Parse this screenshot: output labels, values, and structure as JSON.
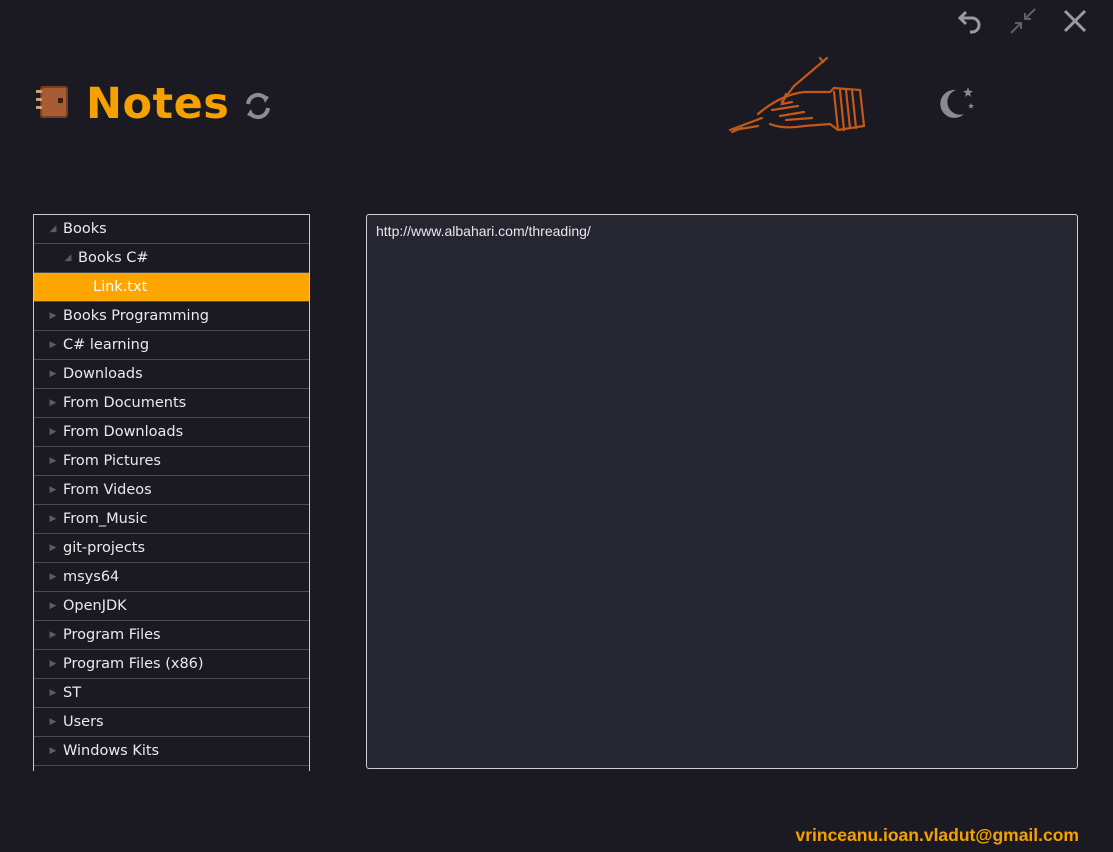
{
  "app": {
    "title": "Notes"
  },
  "window_controls": {
    "icons": [
      "undo-icon",
      "restore-icon",
      "close-icon"
    ]
  },
  "header": {
    "logo_icon": "notebook-icon",
    "refresh_icon": "refresh-icon",
    "illustration": "writing-hand-quill-illustration",
    "theme_icon": "moon-stars-icon"
  },
  "tree": {
    "items": [
      {
        "label": "Books",
        "level": 0,
        "expanded": true
      },
      {
        "label": "Books C#",
        "level": 1,
        "expanded": true
      },
      {
        "label": "Link.txt",
        "level": 2,
        "selected": true
      },
      {
        "label": "Books Programming",
        "level": 0
      },
      {
        "label": "C# learning",
        "level": 0
      },
      {
        "label": "Downloads",
        "level": 0
      },
      {
        "label": "From Documents",
        "level": 0
      },
      {
        "label": "From Downloads",
        "level": 0
      },
      {
        "label": "From Pictures",
        "level": 0
      },
      {
        "label": "From Videos",
        "level": 0
      },
      {
        "label": "From_Music",
        "level": 0
      },
      {
        "label": "git-projects",
        "level": 0
      },
      {
        "label": "msys64",
        "level": 0
      },
      {
        "label": "OpenJDK",
        "level": 0
      },
      {
        "label": "Program Files",
        "level": 0
      },
      {
        "label": "Program Files (x86)",
        "level": 0
      },
      {
        "label": "ST",
        "level": 0
      },
      {
        "label": "Users",
        "level": 0
      },
      {
        "label": "Windows Kits",
        "level": 0
      }
    ]
  },
  "editor": {
    "content": "http://www.albahari.com/threading/"
  },
  "footer": {
    "email": "vrinceanu.ioan.vladut@gmail.com"
  },
  "colors": {
    "accent": "#f5a100",
    "background": "#1b1a23",
    "editor_bg": "#262532",
    "selected_row": "#ffa500"
  }
}
